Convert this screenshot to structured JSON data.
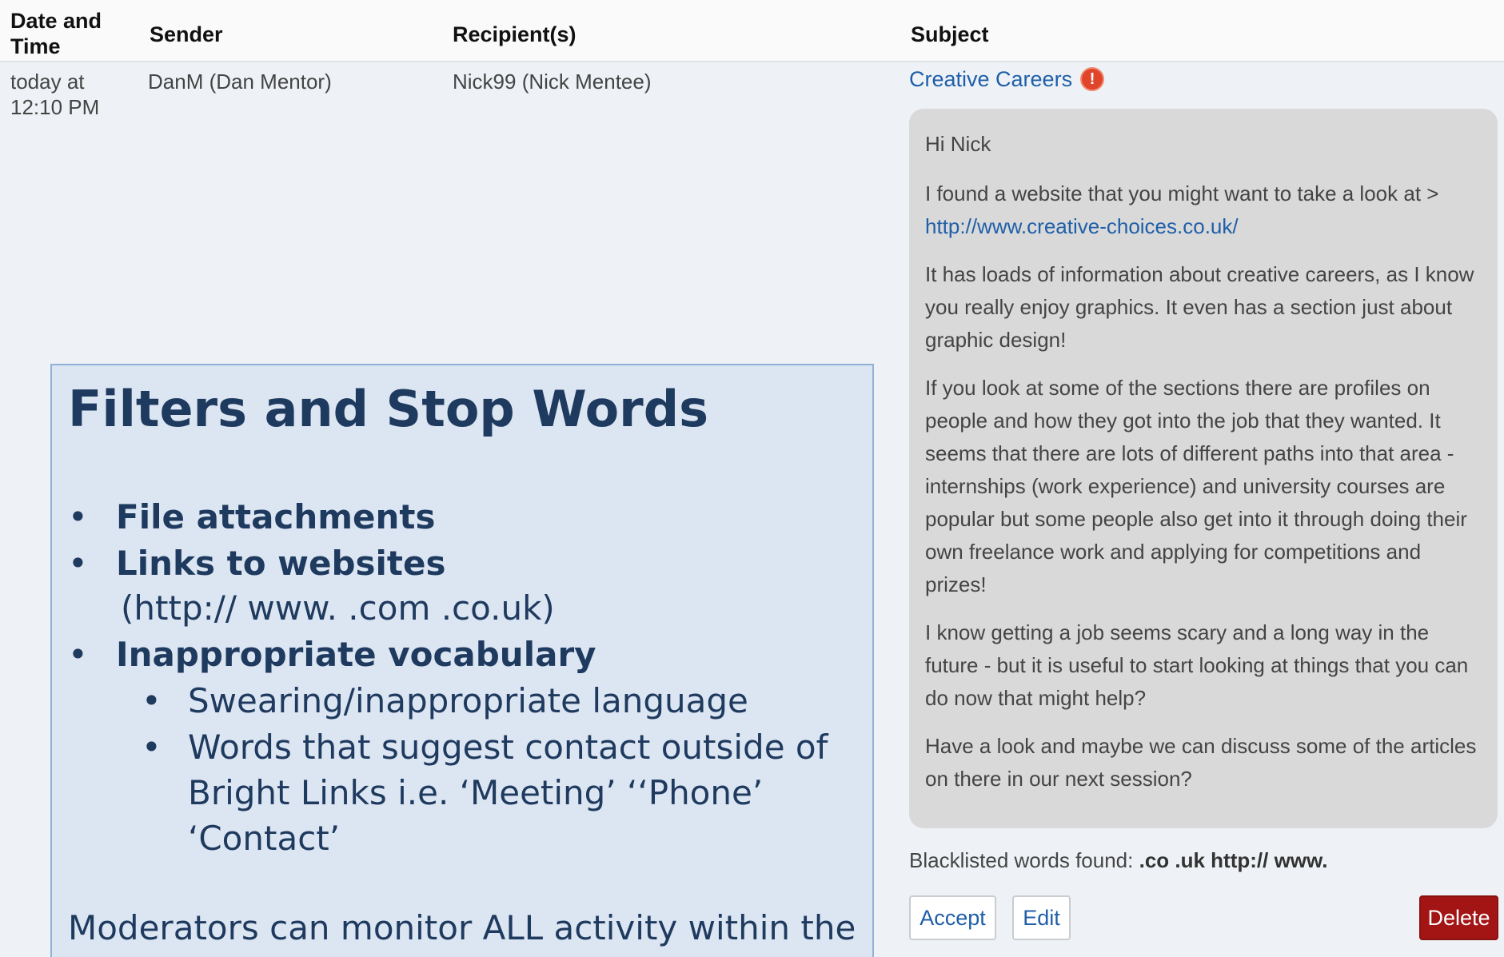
{
  "table": {
    "headers": {
      "date": "Date and Time",
      "sender": "Sender",
      "recipients": "Recipient(s)",
      "subject": "Subject"
    },
    "row": {
      "date": "today at 12:10 PM",
      "sender": "DanM (Dan Mentor)",
      "recipients": "Nick99 (Nick Mentee)",
      "subject": "Creative Careers",
      "subject_icon": "alert-icon",
      "subject_icon_glyph": "!"
    }
  },
  "message": {
    "greeting": "Hi Nick",
    "p1_text": "I found a website that you might want to take a look at > ",
    "p1_url": "http://www.creative-choices.co.uk/",
    "p2": "It has loads of information about creative careers, as I know you really enjoy graphics. It even has a section just about graphic design!",
    "p3": "If you look at some of the sections there are profiles on people and how they got into the job that they wanted. It seems that there are lots of different paths into that area - internships (work experience) and university courses are popular but some people also get into it through doing their own freelance work and applying for competitions and prizes!",
    "p4": "I know getting a job seems scary and a long way in the future - but it is useful to start looking at things that you can do now that might help?",
    "p5": "Have a look and maybe we can discuss some of the articles on there in our next session?"
  },
  "moderation": {
    "blacklist_label": "Blacklisted words found: ",
    "blacklist_words": ".co .uk http:// www.",
    "accept_label": "Accept",
    "edit_label": "Edit",
    "delete_label": "Delete"
  },
  "slide": {
    "title": "Filters and Stop Words",
    "bullet_glyph": "•",
    "item1": "File attachments",
    "item2": "Links to websites",
    "item2_detail": "(http://   www.    .com   .co.uk)",
    "item3": "Inappropriate vocabulary",
    "sub1": "Swearing/inappropriate language",
    "sub2_line1": "Words that suggest contact outside of",
    "sub2_line2": "Bright Links  i.e. ‘Meeting’ ‘‘Phone’",
    "sub2_line3": "‘Contact’",
    "footer": "Moderators can monitor ALL activity within the"
  },
  "colors": {
    "link": "#1f5fa8",
    "delete": "#a31515",
    "slide_bg": "#dce6f2",
    "slide_text": "#1f3a5f",
    "message_bg": "#d9d9d9"
  }
}
